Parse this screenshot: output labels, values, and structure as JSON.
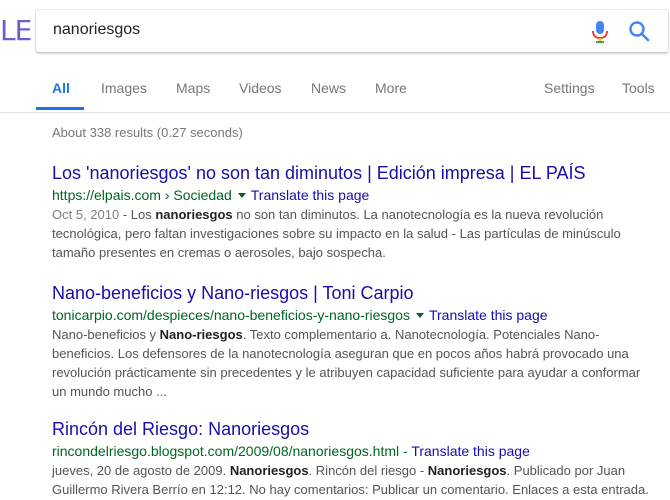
{
  "header": {
    "logo_fragment": "LE",
    "search": {
      "value": "nanoriesgos"
    }
  },
  "tabs": [
    {
      "label": "All"
    },
    {
      "label": "Images"
    },
    {
      "label": "Maps"
    },
    {
      "label": "Videos"
    },
    {
      "label": "News"
    },
    {
      "label": "More"
    },
    {
      "label": "Settings"
    },
    {
      "label": "Tools"
    }
  ],
  "stats": "About 338 results (0.27 seconds)",
  "results": [
    {
      "title": "Los 'nanoriesgos' no son tan diminutos | Edición impresa | EL PAÍS",
      "url": "https://elpais.com › Sociedad",
      "translate": "Translate this page",
      "snippet": {
        "l1_date": "Oct 5, 2010",
        "l1_a": " - Los ",
        "l1_b": "nanoriesgos",
        "l1_c": " no son tan diminutos. La nanotecnología es la nueva revolución",
        "l2": "tecnológica, pero faltan investigaciones sobre su impacto en la salud - Las partículas de minúsculo",
        "l3": "tamaño presentes en cremas o aerosoles, bajo sospecha."
      }
    },
    {
      "title": "Nano-beneficios y Nano-riesgos | Toni Carpio",
      "url": "tonicarpio.com/despieces/nano-beneficios-y-nano-riesgos",
      "translate": "Translate this page",
      "snippet": {
        "l1_a": "Nano-beneficios y ",
        "l1_b": "Nano-riesgos",
        "l1_c": ". Texto complementario a. Nanotecnología. Potenciales Nano-",
        "l2": "beneficios. Los defensores de la nanotecnología aseguran que en pocos años habrá provocado una",
        "l3": "revolución prácticamente sin precedentes y le atribuyen capacidad suficiente para ayudar a conformar",
        "l4": "un mundo mucho ..."
      }
    },
    {
      "title": "Rincón del Riesgo: Nanoriesgos",
      "url": "rincondelriesgo.blogspot.com/2009/08/nanoriesgos.html",
      "sep": " - ",
      "translate": "Translate this page",
      "snippet": {
        "l1_a": "jueves, 20 de agosto de 2009. ",
        "l1_b": "Nanoriesgos",
        "l1_c": ". Rincón del riesgo - ",
        "l1_d": "Nanoriesgos",
        "l1_e": ". Publicado por Juan",
        "l2": "Guillermo Rivera Berrío en 12:12. No hay comentarios: Publicar un comentario. Enlaces a esta entrada."
      }
    }
  ]
}
